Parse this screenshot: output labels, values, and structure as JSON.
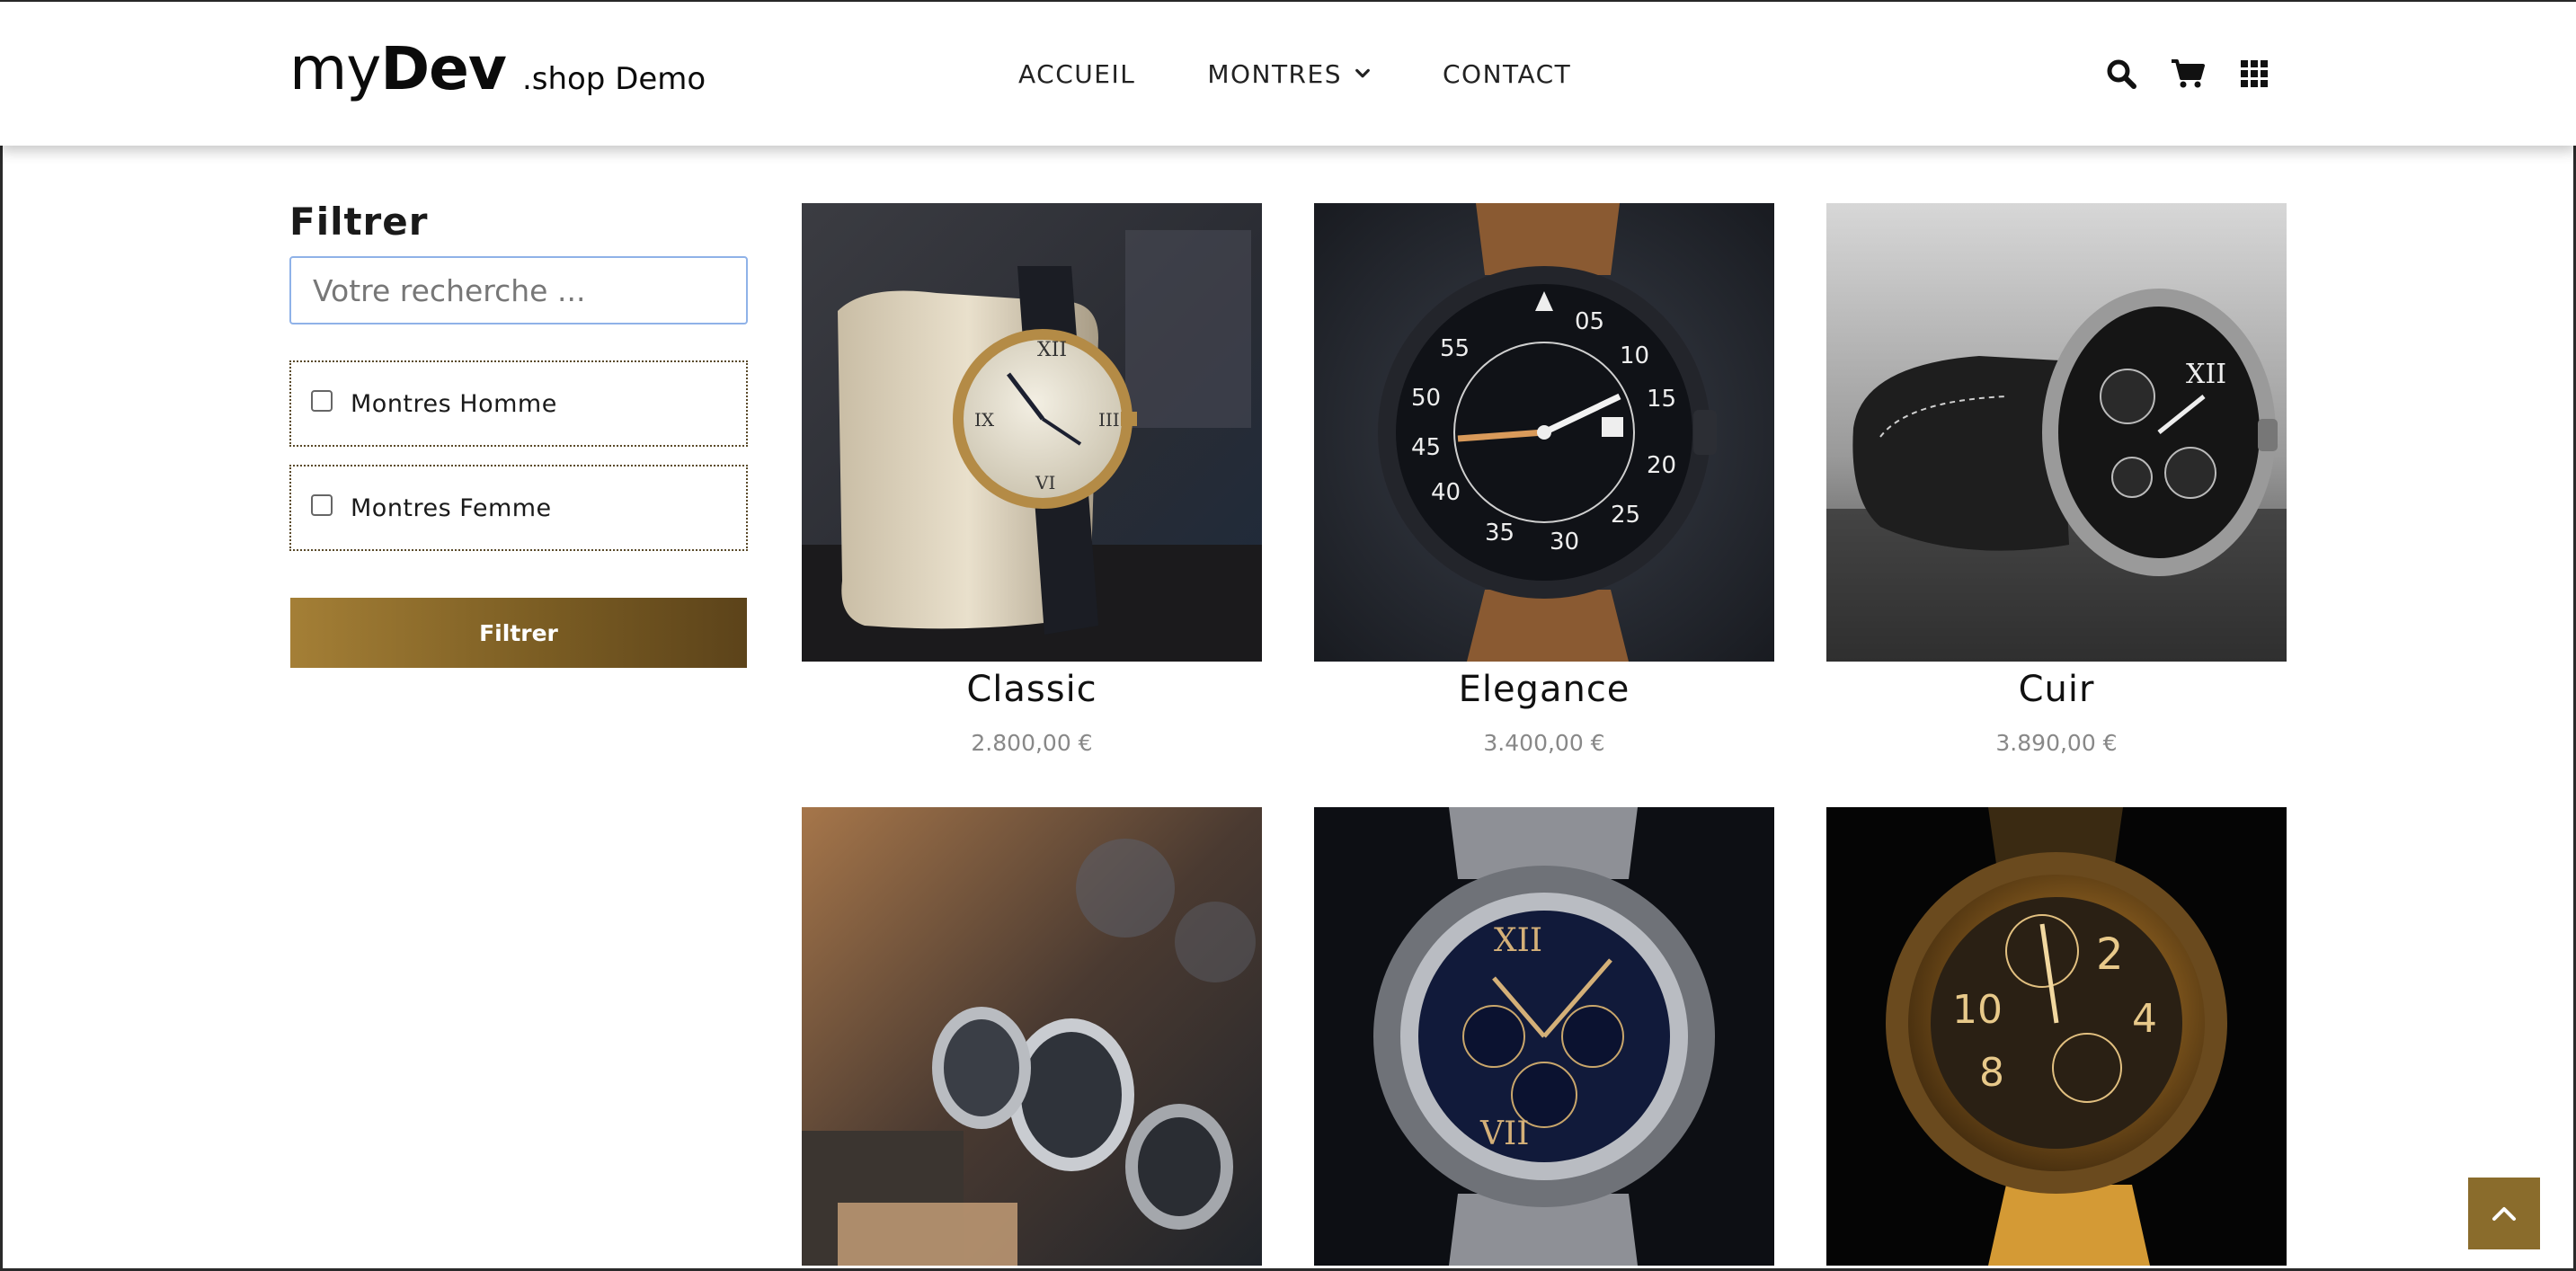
{
  "header": {
    "logo": {
      "part1": "my",
      "part2": "Dev",
      "suffix": ".shop Demo"
    },
    "nav": [
      {
        "label": "ACCUEIL"
      },
      {
        "label": "MONTRES",
        "has_dropdown": true
      },
      {
        "label": "CONTACT"
      }
    ],
    "icons": [
      "search-icon",
      "cart-icon",
      "grid-menu-icon"
    ]
  },
  "sidebar": {
    "title": "Filtrer",
    "search": {
      "placeholder": "Votre recherche ...",
      "value": ""
    },
    "checkboxes": [
      {
        "label": "Montres Homme",
        "checked": false
      },
      {
        "label": "Montres Femme",
        "checked": false
      }
    ],
    "button_label": "Filtrer"
  },
  "products": [
    {
      "name": "Classic",
      "price": "2.800,00 €"
    },
    {
      "name": "Elegance",
      "price": "3.400,00 €"
    },
    {
      "name": "Cuir",
      "price": "3.890,00 €"
    },
    {
      "name": "",
      "price": ""
    },
    {
      "name": "",
      "price": ""
    },
    {
      "name": "",
      "price": ""
    }
  ],
  "colors": {
    "accent_gold": "#8a6c2c",
    "button_gradient_start": "#a47f36",
    "button_gradient_end": "#5c431a",
    "price_grey": "#888888",
    "input_focus_border": "#8fb2e8"
  },
  "scroll_top_icon": "arrow-up-icon"
}
